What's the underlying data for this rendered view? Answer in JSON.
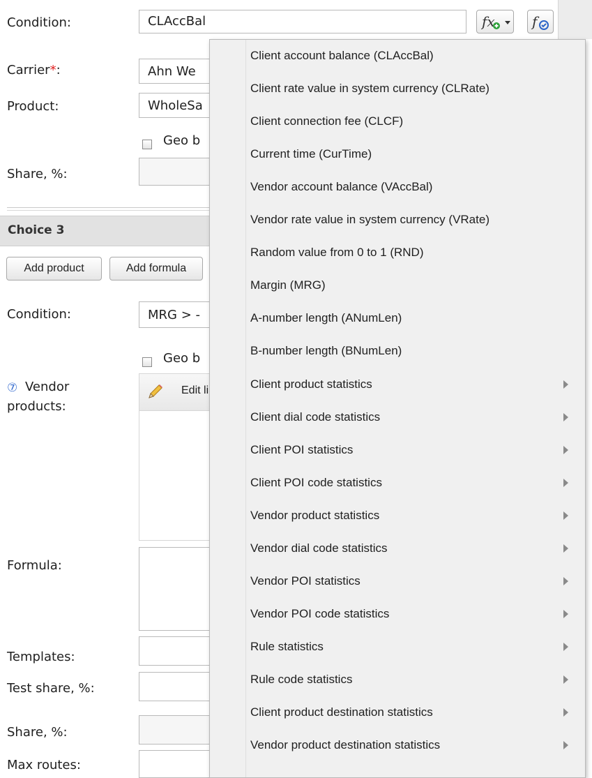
{
  "top_section": {
    "condition_label": "Condition:",
    "condition_value": "CLAccBal",
    "carrier_label": "Carrier",
    "required_mark": "*",
    "carrier_colon": ":",
    "carrier_value": "Ahn We",
    "product_label": "Product:",
    "product_value": "WholeSa",
    "geo_label": "Geo b",
    "share_label": "Share, %:"
  },
  "choice3": {
    "title": "Choice 3",
    "add_product": "Add product",
    "add_formula": "Add formula",
    "condition_label": "Condition:",
    "condition_value": "MRG > -",
    "geo_label": "Geo b",
    "help_mark": "⑦",
    "vendor_label_1": "Vendor",
    "vendor_label_2": "products:",
    "edit_list": "Edit li",
    "formula_label": "Formula:",
    "templates_label": "Templates:",
    "test_share_label": "Test share, %:",
    "share_label": "Share, %:",
    "max_routes_label": "Max routes:"
  },
  "menu": {
    "items": [
      {
        "label": "Client account balance (CLAccBal)",
        "submenu": false
      },
      {
        "label": "Client rate value in system currency (CLRate)",
        "submenu": false
      },
      {
        "label": "Client connection fee (CLCF)",
        "submenu": false
      },
      {
        "label": "Current time (CurTime)",
        "submenu": false
      },
      {
        "label": "Vendor account balance (VAccBal)",
        "submenu": false
      },
      {
        "label": "Vendor rate value in system currency (VRate)",
        "submenu": false
      },
      {
        "label": "Random value from 0 to 1 (RND)",
        "submenu": false
      },
      {
        "label": "Margin (MRG)",
        "submenu": false
      },
      {
        "label": "A-number length (ANumLen)",
        "submenu": false
      },
      {
        "label": "B-number length (BNumLen)",
        "submenu": false
      },
      {
        "label": "Client product statistics",
        "submenu": true
      },
      {
        "label": "Client dial code statistics",
        "submenu": true
      },
      {
        "label": "Client POI statistics",
        "submenu": true
      },
      {
        "label": "Client POI code statistics",
        "submenu": true
      },
      {
        "label": "Vendor product statistics",
        "submenu": true
      },
      {
        "label": "Vendor dial code statistics",
        "submenu": true
      },
      {
        "label": "Vendor POI statistics",
        "submenu": true
      },
      {
        "label": "Vendor POI code statistics",
        "submenu": true
      },
      {
        "label": "Rule statistics",
        "submenu": true
      },
      {
        "label": "Rule code statistics",
        "submenu": true
      },
      {
        "label": "Client product destination statistics",
        "submenu": true
      },
      {
        "label": "Vendor product destination statistics",
        "submenu": true
      }
    ]
  },
  "icons": {
    "insert_function": "fx-insert-function-icon",
    "validate_formula": "fx-validate-formula-icon",
    "pencil": "pencil-icon",
    "submenu": "submenu-arrow-icon"
  },
  "colors": {
    "required": "#e02020",
    "menu_background": "#f0f0f0",
    "section_header": "#e2e2e2",
    "help_icon": "#3a6fd0"
  }
}
